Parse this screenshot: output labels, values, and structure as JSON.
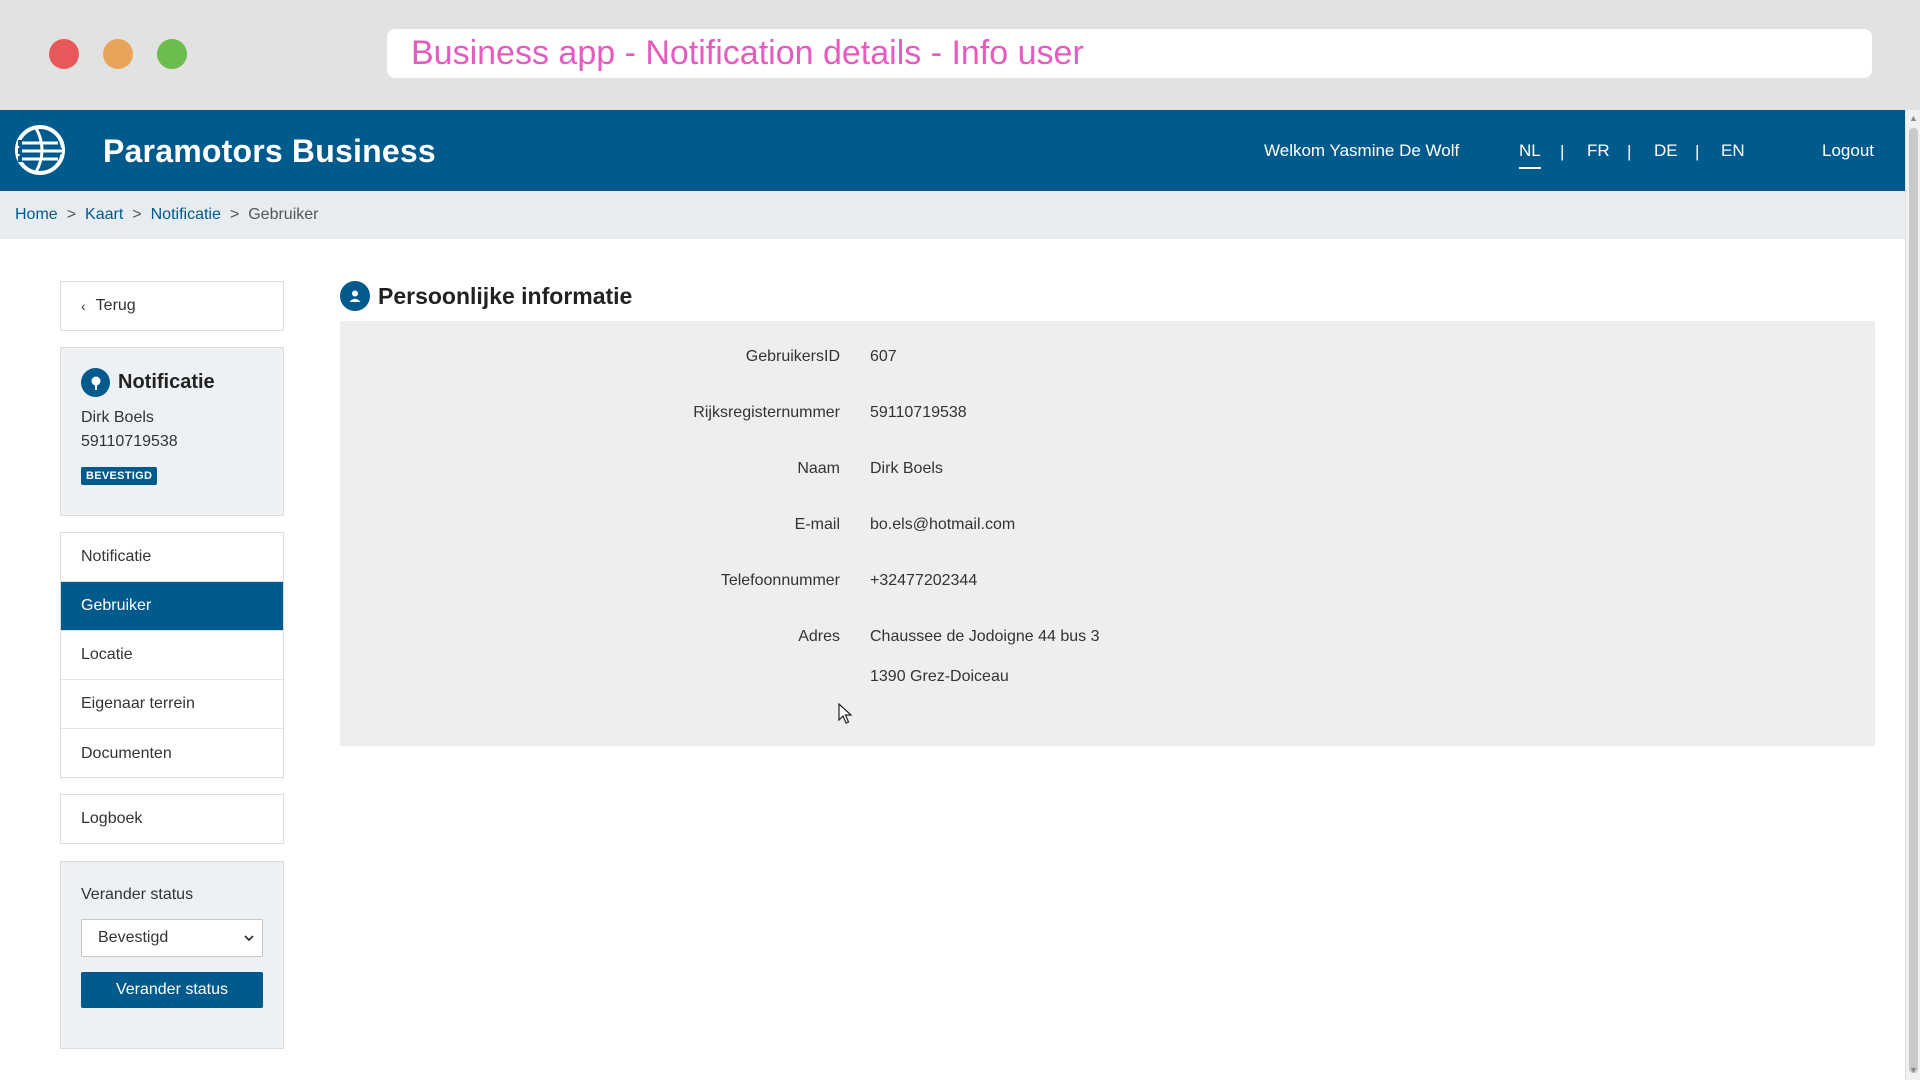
{
  "window": {
    "url_text": "Business app - Notification details - Info user"
  },
  "header": {
    "app_title": "Paramotors Business",
    "welcome": "Welkom Yasmine De Wolf",
    "languages": [
      "NL",
      "FR",
      "DE",
      "EN"
    ],
    "active_language": "NL",
    "logout": "Logout"
  },
  "breadcrumb": {
    "items": [
      "Home",
      "Kaart",
      "Notificatie",
      "Gebruiker"
    ]
  },
  "sidebar": {
    "back_label": "Terug",
    "notification_card": {
      "title": "Notificatie",
      "name": "Dirk Boels",
      "number": "59110719538",
      "badge": "BEVESTIGD"
    },
    "nav_items": [
      "Notificatie",
      "Gebruiker",
      "Locatie",
      "Eigenaar terrein",
      "Documenten"
    ],
    "active_nav": "Gebruiker",
    "logbook_label": "Logboek",
    "status": {
      "label": "Verander status",
      "selected": "Bevestigd",
      "button": "Verander status"
    }
  },
  "main": {
    "section_title": "Persoonlijke informatie",
    "fields": [
      {
        "label": "GebruikersID",
        "value": "607"
      },
      {
        "label": "Rijksregisternummer",
        "value": "59110719538"
      },
      {
        "label": "Naam",
        "value": "Dirk Boels"
      },
      {
        "label": "E-mail",
        "value": "bo.els@hotmail.com"
      },
      {
        "label": "Telefoonnummer",
        "value": "+32477202344"
      },
      {
        "label": "Adres",
        "value": "Chaussee de Jodoigne  44 bus 3"
      }
    ],
    "address_line2": "1390  Grez-Doiceau"
  },
  "colors": {
    "brand": "#005a8c",
    "url_text": "#e55bbf",
    "panel_bg": "#eceeef"
  }
}
